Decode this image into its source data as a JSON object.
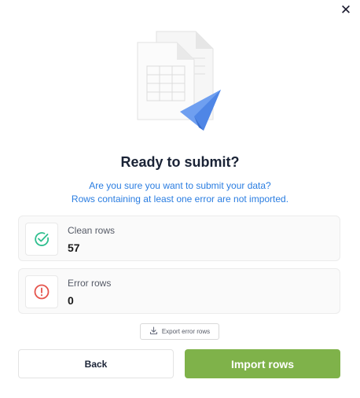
{
  "dialog": {
    "close_icon": "close-icon",
    "illustration": "documents-paper-plane-illustration",
    "title": "Ready to submit?",
    "subtitle_line1": "Are you sure you want to submit your data?",
    "subtitle_line2": "Rows containing at least one error are not imported."
  },
  "stats": {
    "clean": {
      "label": "Clean rows",
      "value": "57",
      "icon": "check-circle-icon",
      "color": "#2fbf8f"
    },
    "error": {
      "label": "Error rows",
      "value": "0",
      "icon": "alert-circle-icon",
      "color": "#e5534b"
    }
  },
  "actions": {
    "export_label": "Export error rows",
    "export_icon": "download-icon",
    "back_label": "Back",
    "import_label": "Import rows",
    "import_color": "#7fb24a"
  }
}
